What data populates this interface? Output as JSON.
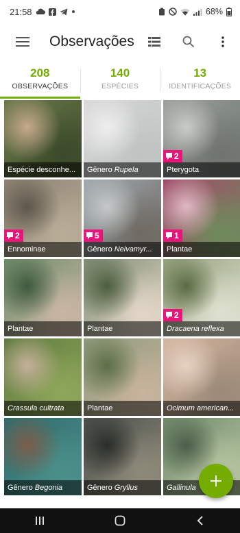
{
  "status_bar": {
    "time": "21:58",
    "battery_text": "68%"
  },
  "app_bar": {
    "title": "Observações",
    "menu_icon": "hamburger-menu-icon",
    "actions": [
      "list-view-icon",
      "search-icon",
      "more-vertical-icon"
    ]
  },
  "stats": {
    "observations": {
      "count": "208",
      "label": "OBSERVAÇÕES"
    },
    "species": {
      "count": "140",
      "label": "ESPÉCIES"
    },
    "identifications": {
      "count": "13",
      "label": "IDENTIFICAÇÕES"
    }
  },
  "observations": [
    {
      "prefix": "Espécie desconhe...",
      "name": "",
      "badge": ""
    },
    {
      "prefix": "Gênero ",
      "name": "Rupela",
      "badge": ""
    },
    {
      "prefix": "Pterygota",
      "name": "",
      "badge": "2"
    },
    {
      "prefix": "Ennominae",
      "name": "",
      "badge": "2"
    },
    {
      "prefix": "Gênero ",
      "name": "Neivamyr...",
      "badge": "5"
    },
    {
      "prefix": "Plantae",
      "name": "",
      "badge": "1"
    },
    {
      "prefix": "Plantae",
      "name": "",
      "badge": ""
    },
    {
      "prefix": "Plantae",
      "name": "",
      "badge": ""
    },
    {
      "prefix": "",
      "name": "Dracaena reflexa",
      "badge": "2"
    },
    {
      "prefix": "",
      "name": "Crassula cultrata",
      "badge": ""
    },
    {
      "prefix": "Plantae",
      "name": "",
      "badge": ""
    },
    {
      "prefix": "",
      "name": "Ocimum american...",
      "badge": ""
    },
    {
      "prefix": "Gênero ",
      "name": "Begonia",
      "badge": ""
    },
    {
      "prefix": "Gênero ",
      "name": "Gryllus",
      "badge": ""
    },
    {
      "prefix": "",
      "name": "Gallinula",
      "badge": ""
    }
  ],
  "colors": {
    "accent": "#74ac00",
    "badge": "#e8157a"
  }
}
